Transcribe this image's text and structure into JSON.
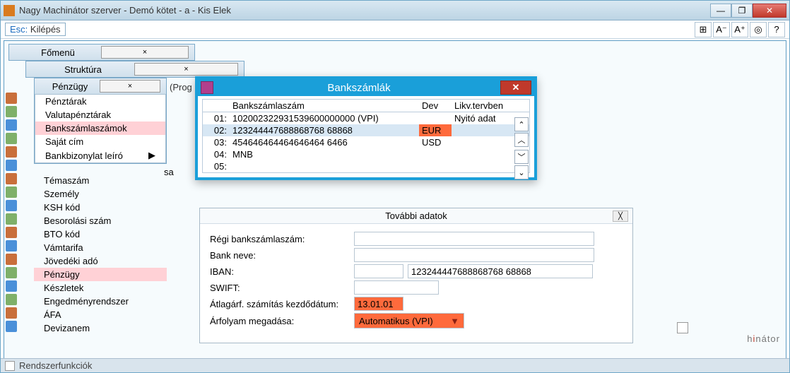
{
  "window": {
    "title": "Nagy Machinátor szerver - Demó kötet - a - Kis Elek",
    "min": "—",
    "max": "❐",
    "close": "✕"
  },
  "toolbar": {
    "esc_label": "Esc:",
    "esc_text": "Kilépés",
    "btn_grid": "⊞",
    "btn_fontdown": "A⁻",
    "btn_fontup": "A⁺",
    "btn_target": "◎",
    "btn_help": "?"
  },
  "panels": {
    "fomenu": "Főmenü",
    "struktura": "Struktúra",
    "penzugy": "Pénzügy",
    "close": "×"
  },
  "penzugy_menu": [
    {
      "label": "Pénztárak",
      "sel": false
    },
    {
      "label": "Valutapénztárak",
      "sel": false
    },
    {
      "label": "Bankszámlaszámok",
      "sel": true
    },
    {
      "label": "Saját cím",
      "sel": false
    },
    {
      "label": "Bankbizonylat leíró",
      "sel": false,
      "arrow": "▶"
    }
  ],
  "side_list": [
    "Témaszám",
    "Személy",
    "KSH kód",
    "Besorolási szám",
    "BTO kód",
    "Vámtarifa",
    "Jövedéki adó",
    "Pénzügy",
    "Készletek",
    "Engedményrendszer",
    "ÁFA",
    "Devizanem"
  ],
  "side_sel_index": 7,
  "side_truncated": "sa",
  "prog_text": "(Prog",
  "bank_dialog": {
    "title": "Bankszámlák",
    "close": "✕",
    "headers": {
      "szam": "Bankszámlaszám",
      "dev": "Dev",
      "likv": "Likv.tervben"
    },
    "rows": [
      {
        "n": "01:",
        "acc": "102002322931539600000000 (VPI)",
        "dev": "",
        "likv": "Nyitó adat",
        "sel": false
      },
      {
        "n": "02:",
        "acc": "123244447688868768 68868",
        "dev": "EUR",
        "likv": "",
        "sel": true,
        "devhl": true
      },
      {
        "n": "03:",
        "acc": "454646464464646464 6466",
        "dev": "USD",
        "likv": "",
        "sel": false
      },
      {
        "n": "04:",
        "acc": "MNB",
        "dev": "",
        "likv": "",
        "sel": false
      },
      {
        "n": "05:",
        "acc": "",
        "dev": "",
        "likv": "",
        "sel": false
      }
    ],
    "scroll": {
      "top": "⌃",
      "up": "︿",
      "down": "﹀",
      "bottom": "⌄"
    }
  },
  "tovabbi": {
    "title": "További adatok",
    "close": "╳",
    "fields": {
      "regi": {
        "label": "Régi bankszámlaszám:",
        "value": ""
      },
      "bank": {
        "label": "Bank neve:",
        "value": ""
      },
      "iban": {
        "label": "IBAN:",
        "prefix": "",
        "value": "123244447688868768 68868"
      },
      "swift": {
        "label": "SWIFT:",
        "value": ""
      },
      "atlag": {
        "label": "Átlagárf. számítás kezdődátum:",
        "value": "13.01.01"
      },
      "arfolyam": {
        "label": "Árfolyam megadása:",
        "value": "Automatikus (VPI)",
        "tri": "▼"
      }
    }
  },
  "logo": {
    "pre": "h",
    "red": "i",
    "post": "nátor"
  },
  "bottom": {
    "label": "Rendszerfunkciók"
  }
}
